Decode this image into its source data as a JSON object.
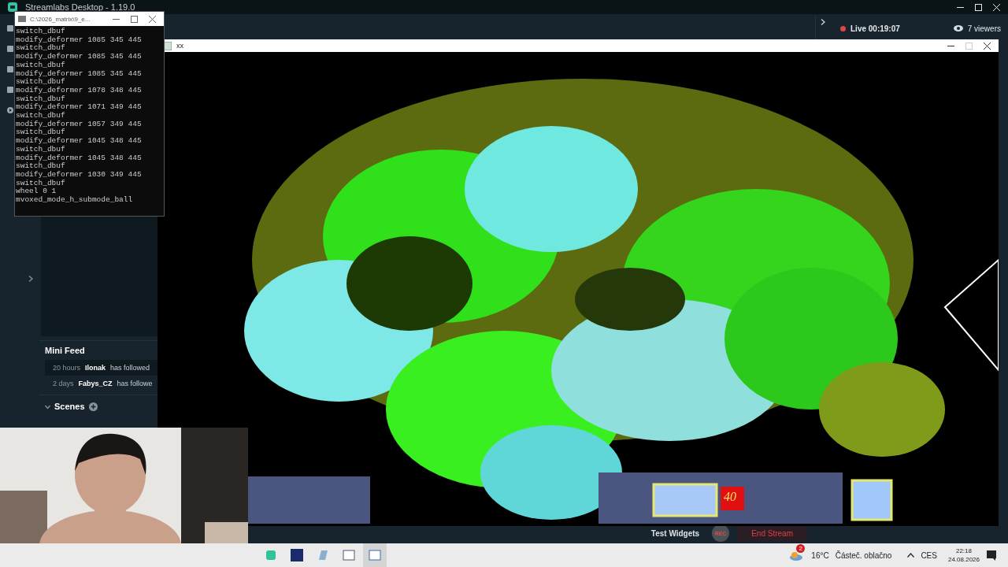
{
  "app_window": {
    "title": "Streamlabs Desktop - 1.19.0",
    "live": {
      "label": "Live",
      "time": "00:19:07"
    },
    "viewers": "7 viewers"
  },
  "mini_feed": {
    "title": "Mini Feed",
    "items": [
      {
        "time": "20 hours",
        "user": "Ilonak",
        "action": "has followed",
        "selected": true
      },
      {
        "time": "2 days",
        "user": "Fabys_CZ",
        "action": "has followe",
        "selected": false
      }
    ]
  },
  "scenes": {
    "title": "Scenes",
    "expanded": true
  },
  "console_window": {
    "title": "C:\\2026_matrix\\9_e...",
    "lines": [
      "switch_dbuf",
      "modify_deformer 1085 345 445",
      "switch_dbuf",
      "modify_deformer 1085 345 445",
      "switch_dbuf",
      "modify_deformer 1085 345 445",
      "switch_dbuf",
      "modify_deformer 1078 348 445",
      "switch_dbuf",
      "modify_deformer 1071 349 445",
      "switch_dbuf",
      "modify_deformer 1057 349 445",
      "switch_dbuf",
      "modify_deformer 1045 348 445",
      "switch_dbuf",
      "modify_deformer 1045 348 445",
      "switch_dbuf",
      "modify_deformer 1030 349 445",
      "switch_dbuf",
      "wheel 0 1",
      "mvoxed_mode_h_submode_ball"
    ]
  },
  "render_window": {
    "title": "xx",
    "hud_counter": "40"
  },
  "footer": {
    "test_widgets": "Test Widgets",
    "rec": "REC",
    "end_stream": "End Stream"
  },
  "taskbar": {
    "weather_badge": "2",
    "temperature": "16°C",
    "weather_text": "Částeč. oblačno",
    "language": "CES",
    "time": "22:18",
    "date": "24.08.2026"
  }
}
